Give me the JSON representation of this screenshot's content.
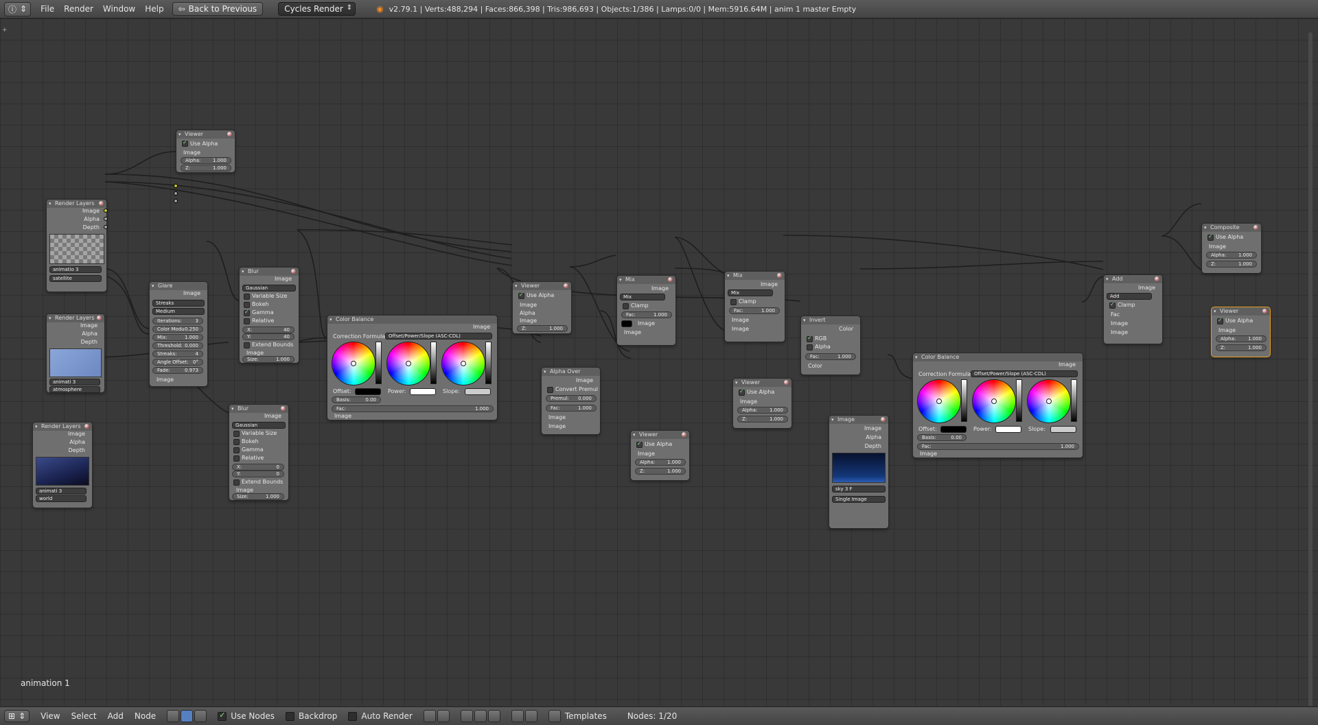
{
  "topbar": {
    "info_icon": "info-icon",
    "menus": [
      "File",
      "Render",
      "Window",
      "Help"
    ],
    "back_button": "Back to Previous",
    "engine": "Cycles Render",
    "stats": "v2.79.1 | Verts:488,294 | Faces:866,398 | Tris:986,693 | Objects:1/386 | Lamps:0/0 | Mem:5916.64M | anim 1 master Empty"
  },
  "labels": {
    "render_layers": "Render Layers",
    "viewer": "Viewer",
    "composite": "Composite",
    "glare": "Glare",
    "blur": "Blur",
    "color_balance": "Color Balance",
    "alpha_over": "Alpha Over",
    "mix": "Mix",
    "invert": "Invert",
    "image_node": "Image",
    "add": "Add",
    "image": "Image",
    "alpha": "Alpha",
    "depth": "Depth",
    "use_alpha": "Use Alpha",
    "fac": "Fac",
    "color": "Color",
    "clamp": "Clamp",
    "gaussian": "Gaussian",
    "variable_size": "Variable Size",
    "bokeh": "Bokeh",
    "gamma": "Gamma",
    "relative": "Relative",
    "extend_bounds": "Extend Bounds",
    "correction_formula": "Correction Formula:",
    "cdl": "Offset/Power/Slope (ASC-CDL)",
    "offset": "Offset:",
    "power": "Power:",
    "slope": "Slope:",
    "convert_premul": "Convert Premul",
    "rgb": "RGB",
    "single_image": "Single Image",
    "streaks": "Streaks",
    "medium": "Medium"
  },
  "fields": {
    "alpha": "Alpha:",
    "z": "Z:",
    "fac": "Fac:",
    "x": "X:",
    "y": "Y:",
    "size": "Size:",
    "basis": "Basis:",
    "premul": "Premul:",
    "iterations": "Iterations:",
    "color_mod": "Color Modu",
    "mix": "Mix:",
    "threshold": "Threshold:",
    "streaks": "Streaks:",
    "angle_offset": "Angle Offset:",
    "fade": "Fade:"
  },
  "values": {
    "one": "1.000",
    "zero": "0.000",
    "basis": "0.00",
    "x40": "40",
    "y40": "40",
    "x0": "0",
    "y0": "0",
    "iterations": "3",
    "color_mod": "0.250",
    "mix": "1.000",
    "threshold": "0.000",
    "streaks": "4",
    "angle_offset": "0°",
    "fade": "0.973"
  },
  "render_layers": [
    {
      "scene": "animatio",
      "users": "3",
      "layer": "satellite"
    },
    {
      "scene": "animati",
      "users": "3",
      "layer": "atmosphere"
    },
    {
      "scene": "animati",
      "users": "3",
      "layer": "world"
    }
  ],
  "image_node": {
    "image_name": "sky",
    "users": "3",
    "flag": "F"
  },
  "status": {
    "animation_label": "animation 1"
  },
  "bottombar": {
    "menus": [
      "View",
      "Select",
      "Add",
      "Node"
    ],
    "use_nodes": "Use Nodes",
    "backdrop": "Backdrop",
    "auto_render": "Auto Render",
    "templates": "Templates",
    "nodes_count": "Nodes: 1/20"
  },
  "colors": {
    "background": "#393939",
    "node_body": "#6f6f6f",
    "socket_image": "#c7c729",
    "socket_value": "#a1a1a1",
    "active_outline": "#e8a020"
  }
}
